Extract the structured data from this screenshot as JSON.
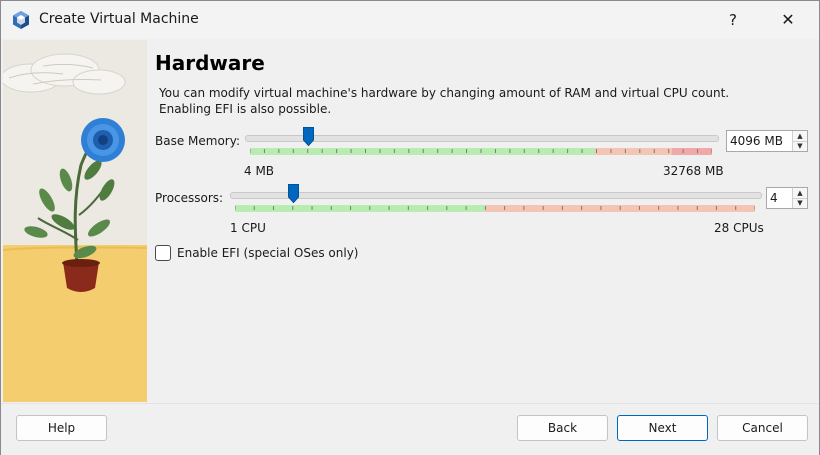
{
  "window": {
    "title": "Create Virtual Machine",
    "help_glyph": "?",
    "close_glyph": "✕"
  },
  "page": {
    "title": "Hardware",
    "description_line1": "You can modify virtual machine's hardware by changing amount of RAM and virtual CPU count.",
    "description_line2": "Enabling EFI is also possible."
  },
  "memory": {
    "label": "Base Memory:",
    "value_text": "4096 MB",
    "min_label": "4 MB",
    "max_label": "32768 MB",
    "value_mb": 4096,
    "min_mb": 4,
    "max_mb": 32768
  },
  "processors": {
    "label": "Processors:",
    "value_text": "4",
    "min_label": "1 CPU",
    "max_label": "28 CPUs",
    "value": 4,
    "min": 1,
    "max": 28
  },
  "efi": {
    "label": "Enable EFI (special OSes only)",
    "checked": false
  },
  "buttons": {
    "help": "Help",
    "back": "Back",
    "next": "Next",
    "cancel": "Cancel"
  },
  "colors": {
    "accent": "#0067c0",
    "scale_ok": "#b8ecb0",
    "scale_warn": "#f4c5b4",
    "scale_bad": "#f0a8a8"
  },
  "icons": {
    "app": "virtualbox-cube-icon",
    "spin_up": "arrow-up-icon",
    "spin_down": "arrow-down-icon"
  }
}
